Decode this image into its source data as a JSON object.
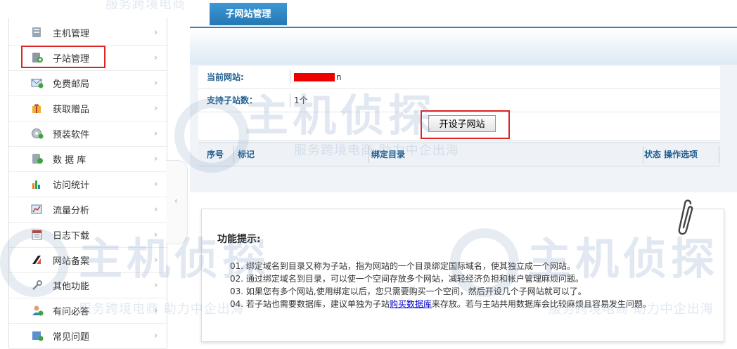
{
  "sidebar": {
    "items": [
      {
        "label": "主机管理",
        "icon": "server-icon"
      },
      {
        "label": "子站管理",
        "icon": "subsite-icon"
      },
      {
        "label": "免费邮局",
        "icon": "mail-icon"
      },
      {
        "label": "获取赠品",
        "icon": "gift-icon"
      },
      {
        "label": "预装软件",
        "icon": "software-icon"
      },
      {
        "label": "数 据 库",
        "icon": "database-icon"
      },
      {
        "label": "访问统计",
        "icon": "stats-icon"
      },
      {
        "label": "流量分析",
        "icon": "traffic-icon"
      },
      {
        "label": "日志下载",
        "icon": "log-download-icon"
      },
      {
        "label": "网站备案",
        "icon": "record-icon"
      },
      {
        "label": "其他功能",
        "icon": "tool-icon"
      },
      {
        "label": "有问必答",
        "icon": "qa-icon"
      },
      {
        "label": "常见问题",
        "icon": "faq-icon"
      }
    ],
    "selected_index": 1,
    "arrow": "›",
    "collapse_arrow": "‹"
  },
  "tab": {
    "label": "子网站管理"
  },
  "info": {
    "current_site_label": "当前网站:",
    "current_site_value_suffix": "n",
    "subsite_count_label": "支持子站数：",
    "subsite_count_value": "1个"
  },
  "open_button": {
    "label": "开设子网站"
  },
  "table": {
    "headers": [
      "序号",
      "标记",
      "绑定目录",
      "状态",
      "操作选项"
    ]
  },
  "tips": {
    "title": "功能提示:",
    "lines": [
      "01. 绑定域名到目录又称为子站，指为网站的一个目录绑定国际域名，使其独立成一个网站。",
      "02. 通过绑定域名到目录，可以使一个空间存放多个网站，减轻经济负担和帐户管理麻烦问题。",
      "03. 如果您有多个网站,使用绑定以后，您只需要购买一个空间，然后开设几个子网站就可以了。"
    ],
    "line4_prefix": "04. 若子站也需要数据库，建议单独为子站",
    "line4_link": "购买数据库",
    "line4_suffix": "来存放。若与主站共用数据库会比较麻烦且容易发生问题。"
  },
  "watermark": {
    "brand": "主机侦探",
    "slogan": "服务跨境电商 助力中企出海"
  },
  "colors": {
    "accent": "#2a86c2",
    "highlight": "#e02424",
    "link": "#0000cc"
  }
}
